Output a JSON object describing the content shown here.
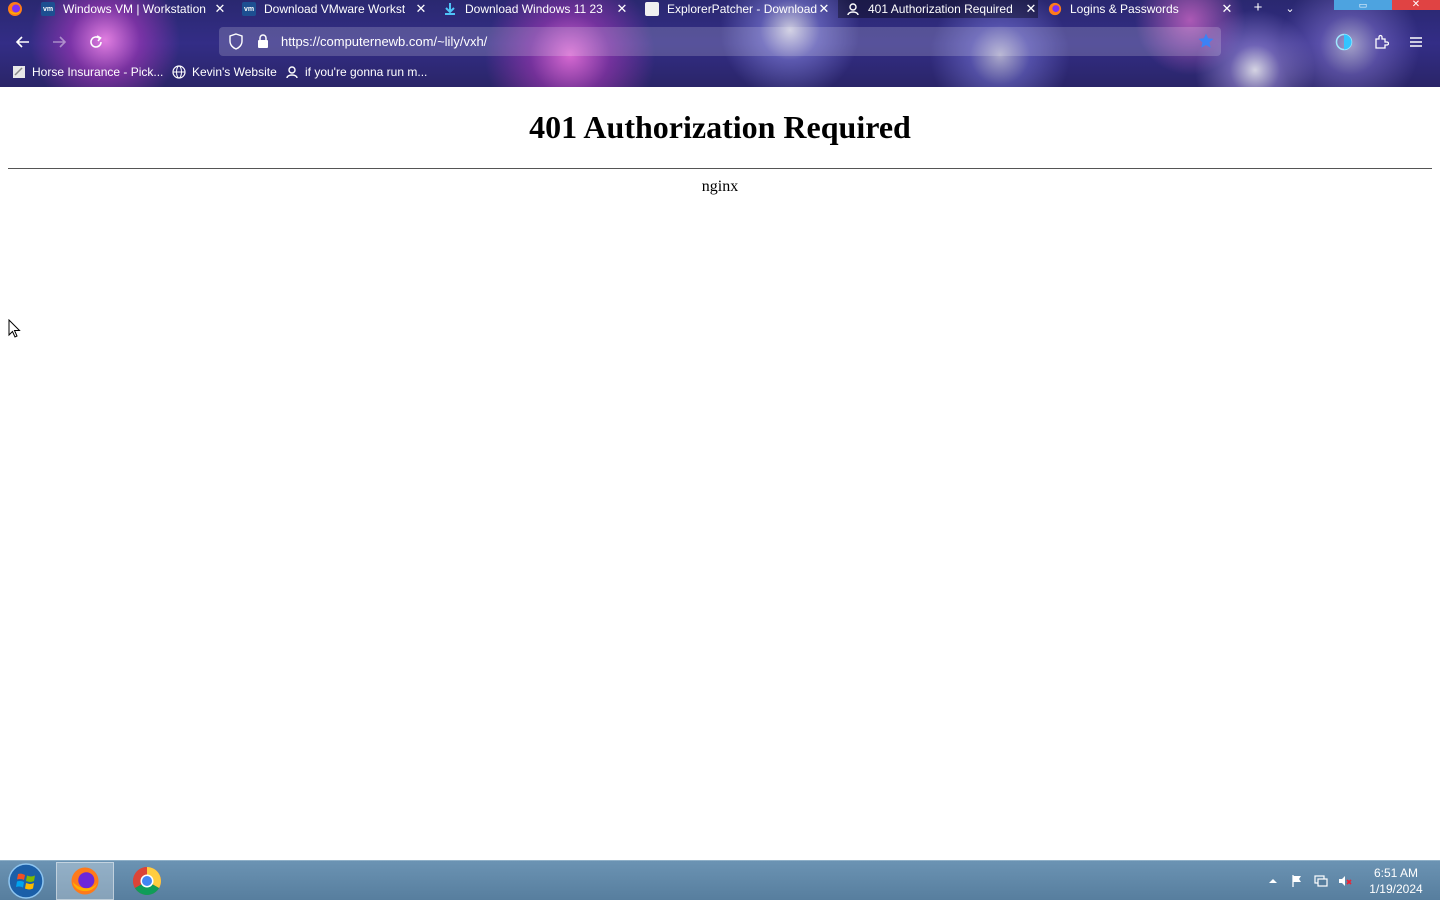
{
  "browser": {
    "tabs": [
      {
        "title": "Windows VM | Workstation",
        "favicon": "vmware-icon",
        "active": false
      },
      {
        "title": "Download VMware Workst",
        "favicon": "vmware-icon",
        "active": false
      },
      {
        "title": "Download Windows 11 23",
        "favicon": "download-icon",
        "active": false
      },
      {
        "title": "ExplorerPatcher - Download",
        "favicon": "page-icon",
        "active": false
      },
      {
        "title": "401 Authorization Required",
        "favicon": "user-icon",
        "active": true
      },
      {
        "title": "Logins & Passwords",
        "favicon": "firefox-icon",
        "active": false
      }
    ],
    "url": "https://computernewb.com/~lily/vxh/",
    "bookmarks": [
      {
        "label": "Horse Insurance - Pick...",
        "icon": "page-icon"
      },
      {
        "label": "Kevin's Website",
        "icon": "globe-icon"
      },
      {
        "label": "if you're gonna run m...",
        "icon": "user-icon"
      }
    ],
    "colors": {
      "accent": "#3b82f6",
      "chrome_bg": "#2f2b7a"
    }
  },
  "page": {
    "heading": "401 Authorization Required",
    "server": "nginx"
  },
  "taskbar": {
    "apps": [
      "Firefox",
      "Chrome"
    ],
    "time": "6:51 AM",
    "date": "1/19/2024"
  }
}
